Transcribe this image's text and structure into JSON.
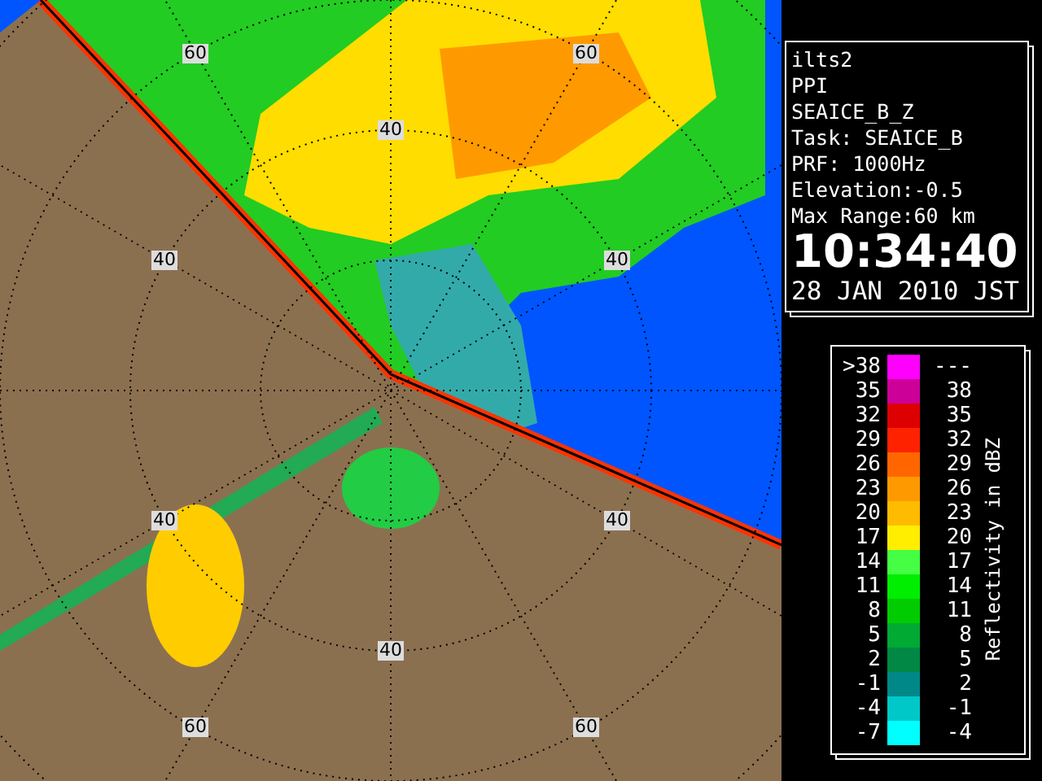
{
  "radar_map": {
    "range_labels": [
      "60",
      "60",
      "40",
      "40",
      "40",
      "40",
      "40",
      "40",
      "60",
      "60"
    ]
  },
  "info_panel": {
    "lines": [
      "ilts2",
      "PPI",
      "SEAICE_B_Z",
      "Task: SEAICE_B",
      "PRF: 1000Hz",
      "Elevation:-0.5",
      "Max Range:60 km"
    ],
    "time": "10:34:40",
    "date": "28 JAN 2010 JST"
  },
  "legend": {
    "title": "Reflectivity in dBZ",
    "rows": [
      {
        "low": ">38",
        "high": "---",
        "color": "#ff00ff"
      },
      {
        "low": "35",
        "high": "38",
        "color": "#cc0099"
      },
      {
        "low": "32",
        "high": "35",
        "color": "#dd0000"
      },
      {
        "low": "29",
        "high": "32",
        "color": "#ff2200"
      },
      {
        "low": "26",
        "high": "29",
        "color": "#ff6600"
      },
      {
        "low": "23",
        "high": "26",
        "color": "#ff9900"
      },
      {
        "low": "20",
        "high": "23",
        "color": "#ffbb00"
      },
      {
        "low": "17",
        "high": "20",
        "color": "#ffee00"
      },
      {
        "low": "14",
        "high": "17",
        "color": "#44ff44"
      },
      {
        "low": "11",
        "high": "14",
        "color": "#00ee00"
      },
      {
        "low": "8",
        "high": "11",
        "color": "#00cc00"
      },
      {
        "low": "5",
        "high": "8",
        "color": "#00aa33"
      },
      {
        "low": "2",
        "high": "5",
        "color": "#008844"
      },
      {
        "low": "-1",
        "high": "2",
        "color": "#008888"
      },
      {
        "low": "-4",
        "high": "-1",
        "color": "#00c8c8"
      },
      {
        "low": "-7",
        "high": "-4",
        "color": "#00ffff"
      }
    ]
  }
}
